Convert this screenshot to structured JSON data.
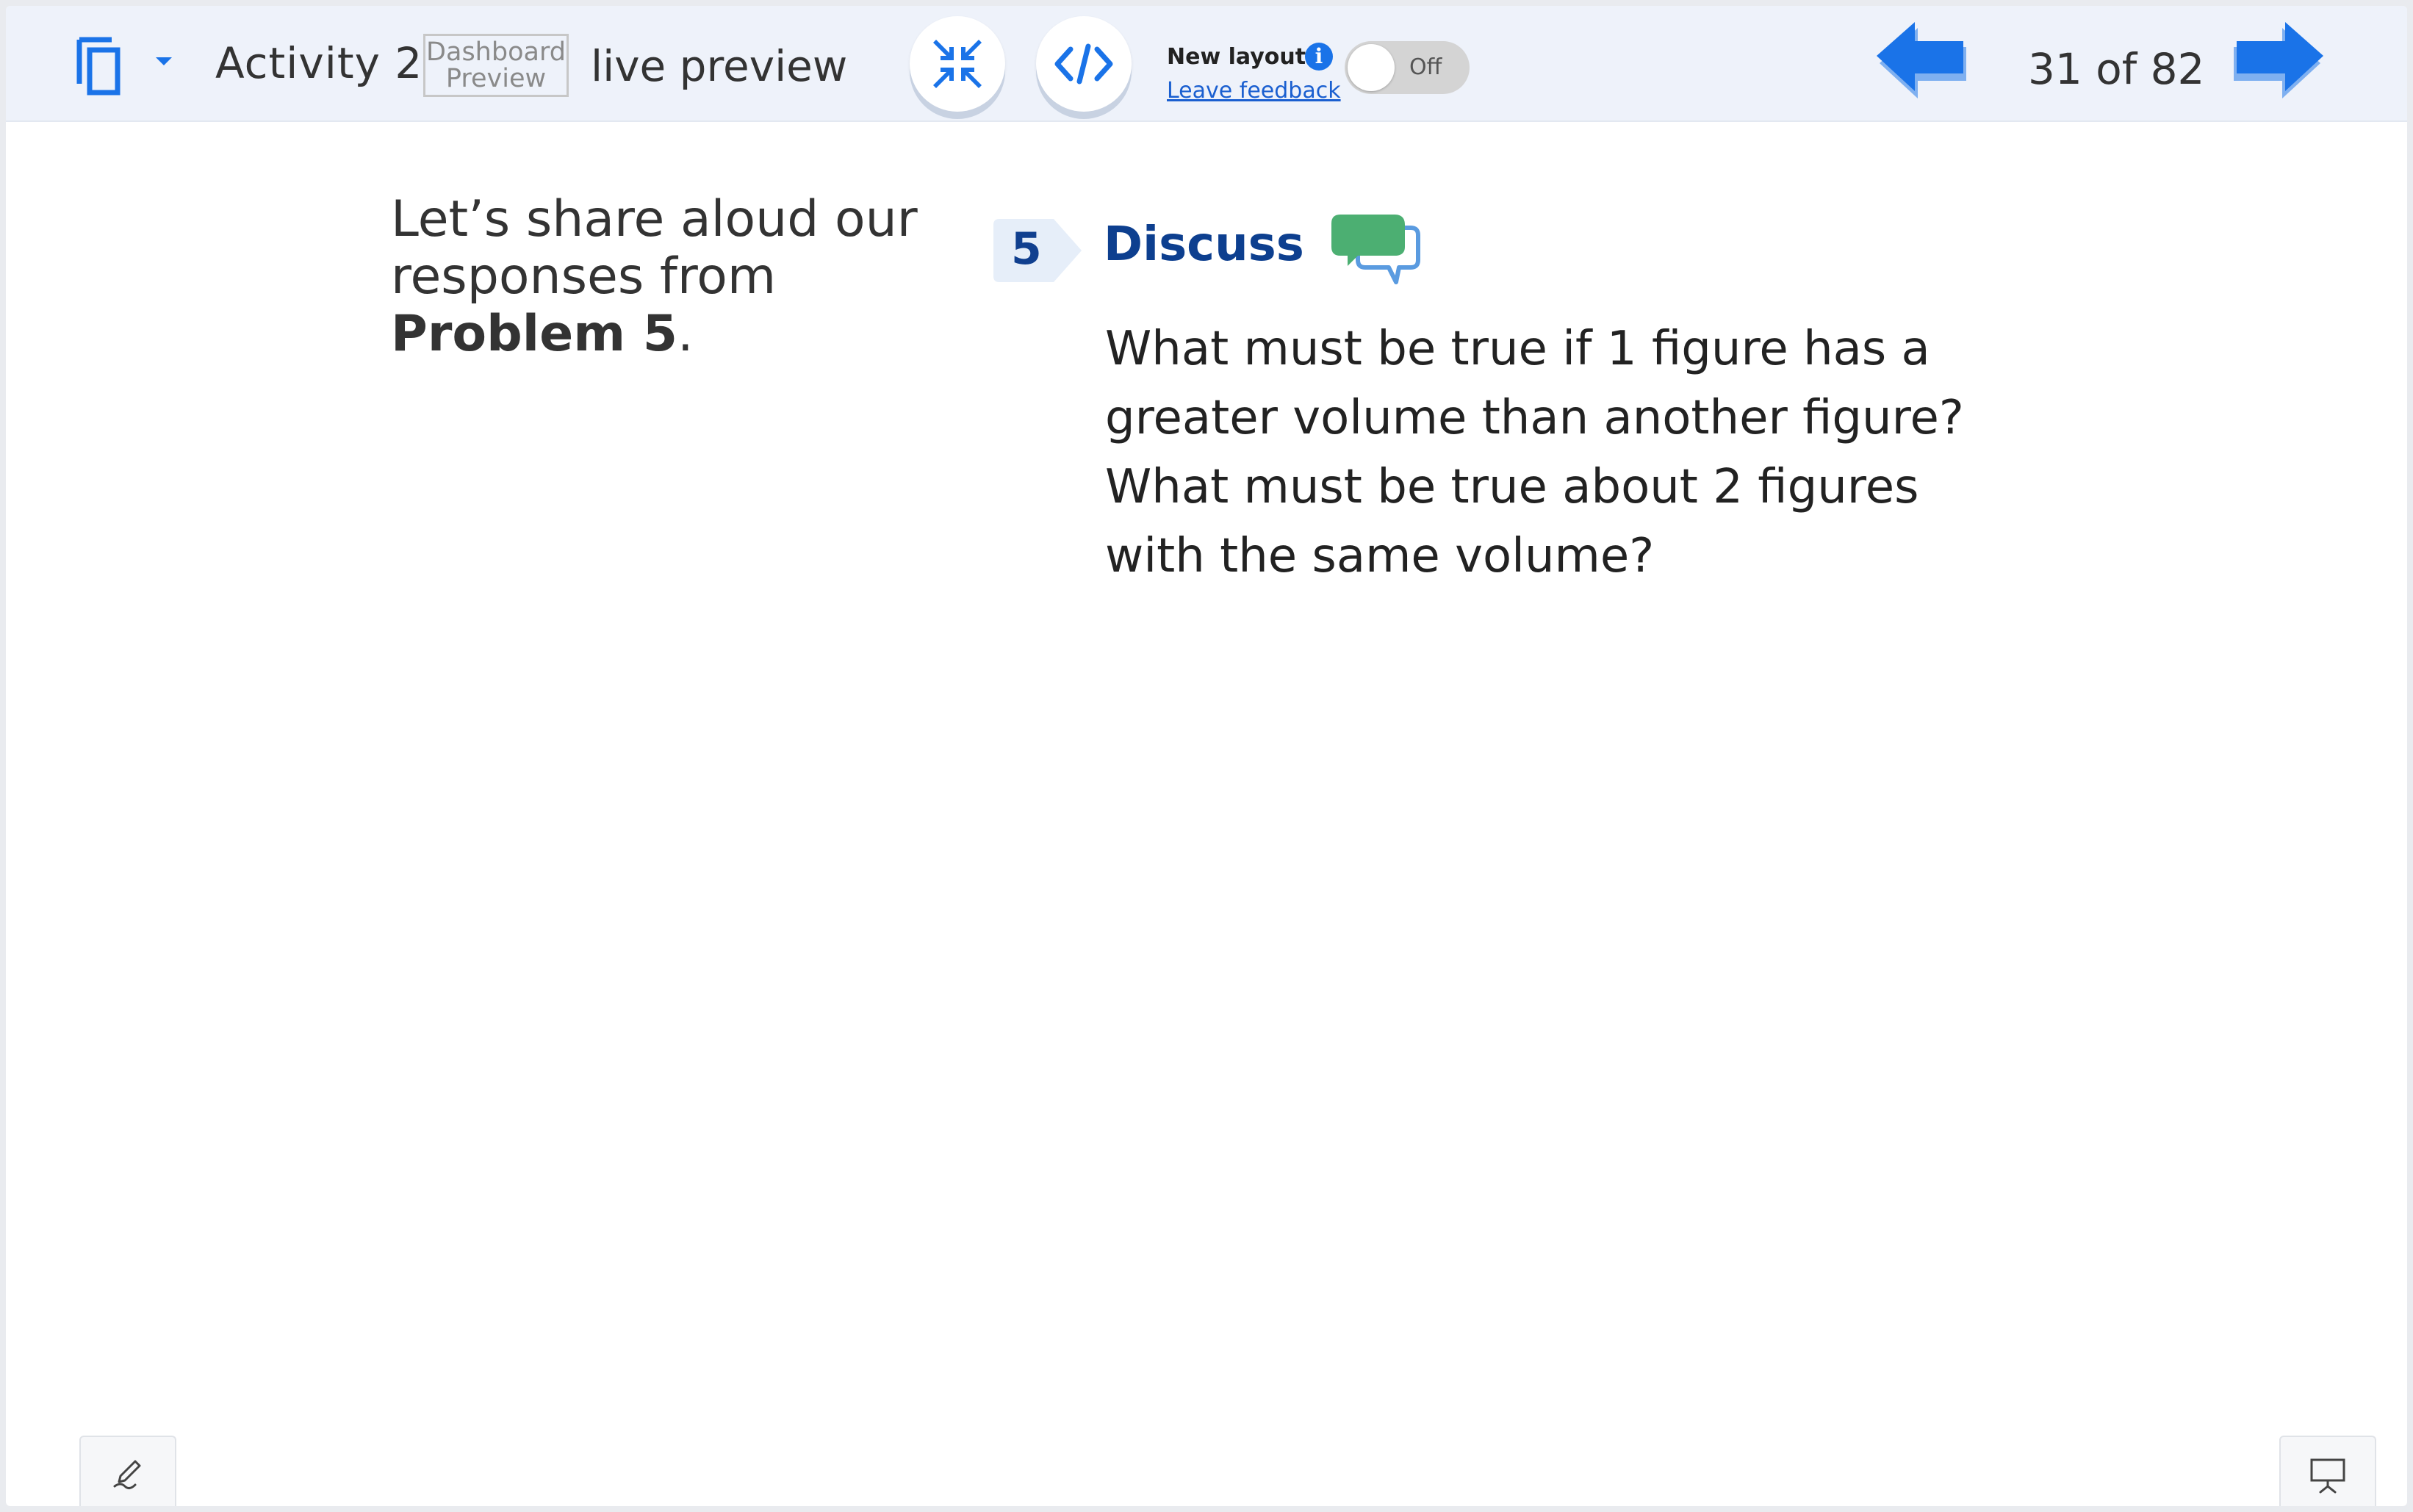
{
  "header": {
    "activity_title": "Activity 2",
    "badge_line1": "Dashboard",
    "badge_line2": "Preview",
    "live_preview": "live preview",
    "new_layout_label": "New layout",
    "info_glyph": "i",
    "feedback_link": "Leave feedback",
    "toggle_state": "Off",
    "page_counter": "31 of 82",
    "icons": [
      "copy-icon",
      "chevron-down-icon",
      "collapse-icon",
      "code-icon",
      "info-icon",
      "arrow-left-icon",
      "arrow-right-icon"
    ],
    "accent_color": "#1a73e8"
  },
  "content": {
    "intro_prefix": "Let’s share aloud our responses from",
    "intro_bold": "Problem 5",
    "intro_suffix": ".",
    "step_number": "5",
    "step_title": "Discuss",
    "question": "What must be true if 1 figure has a greater volume than another figure? What must be true about 2 figures with the same volume?",
    "title_color": "#0d3f8f",
    "chat_icon_color": "#4caf72"
  },
  "footer": {
    "icons": [
      "pen-icon",
      "presentation-icon"
    ]
  }
}
